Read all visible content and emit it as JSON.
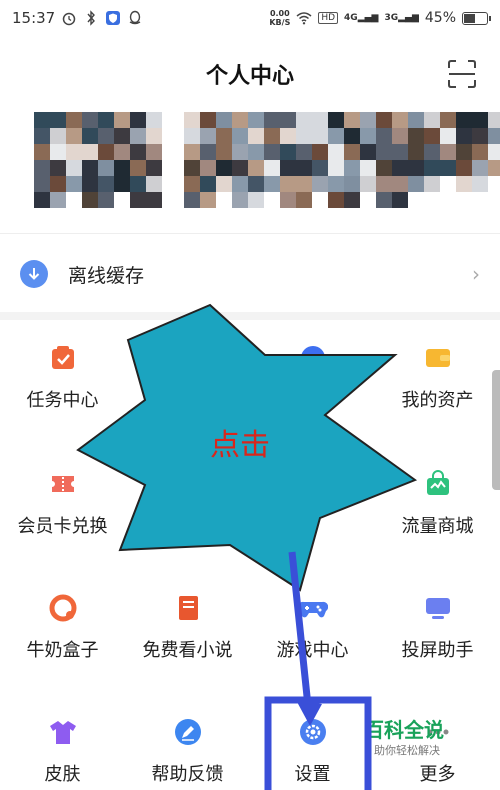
{
  "status_bar": {
    "time": "15:37",
    "net_speed_value": "0.00",
    "net_speed_unit": "KB/S",
    "hd": "HD",
    "signal_1": "4G",
    "signal_2": "3G",
    "battery": "45%",
    "battery_level": 0.45
  },
  "header": {
    "title": "个人中心"
  },
  "offline_cache": {
    "label": "离线缓存"
  },
  "grid": [
    {
      "label": "任务中心",
      "icon": "task-icon",
      "color": "#f0673a"
    },
    {
      "label": "",
      "icon": "hidden-icon",
      "color": "#3d6ff0"
    },
    {
      "label": "",
      "icon": "hidden-icon",
      "color": "#3d6ff0"
    },
    {
      "label": "我的资产",
      "icon": "wallet-icon",
      "color": "#f7b731"
    },
    {
      "label": "会员卡兑换",
      "icon": "ticket-icon",
      "color": "#f06b5b"
    },
    {
      "label": "流量商城",
      "icon": "shop-bag-icon",
      "color": "#2ec27e"
    },
    {
      "label": "牛奶盒子",
      "icon": "milk-box-icon",
      "color": "#f0673a"
    },
    {
      "label": "免费看小说",
      "icon": "book-icon",
      "color": "#e8572f"
    },
    {
      "label": "游戏中心",
      "icon": "gamepad-icon",
      "color": "#4a78f0"
    },
    {
      "label": "投屏助手",
      "icon": "cast-screen-icon",
      "color": "#6b7ff0"
    },
    {
      "label": "皮肤",
      "icon": "shirt-icon",
      "color": "#8e5cf0"
    },
    {
      "label": "帮助反馈",
      "icon": "pen-icon",
      "color": "#3d86f0"
    },
    {
      "label": "设置",
      "icon": "gear-icon",
      "color": "#4a7ff0"
    },
    {
      "label": "更多",
      "icon": "more-icon",
      "color": "#888888"
    }
  ],
  "annotation": {
    "star_text": "点击",
    "star_color": "#1ba4c0",
    "arrow_color": "#3a4fd8"
  },
  "watermark": {
    "title": "百科全说",
    "subtitle": "助你轻松解决"
  },
  "colors": {
    "accent_blue": "#5b8ff0",
    "divider": "#f3f3f3"
  }
}
